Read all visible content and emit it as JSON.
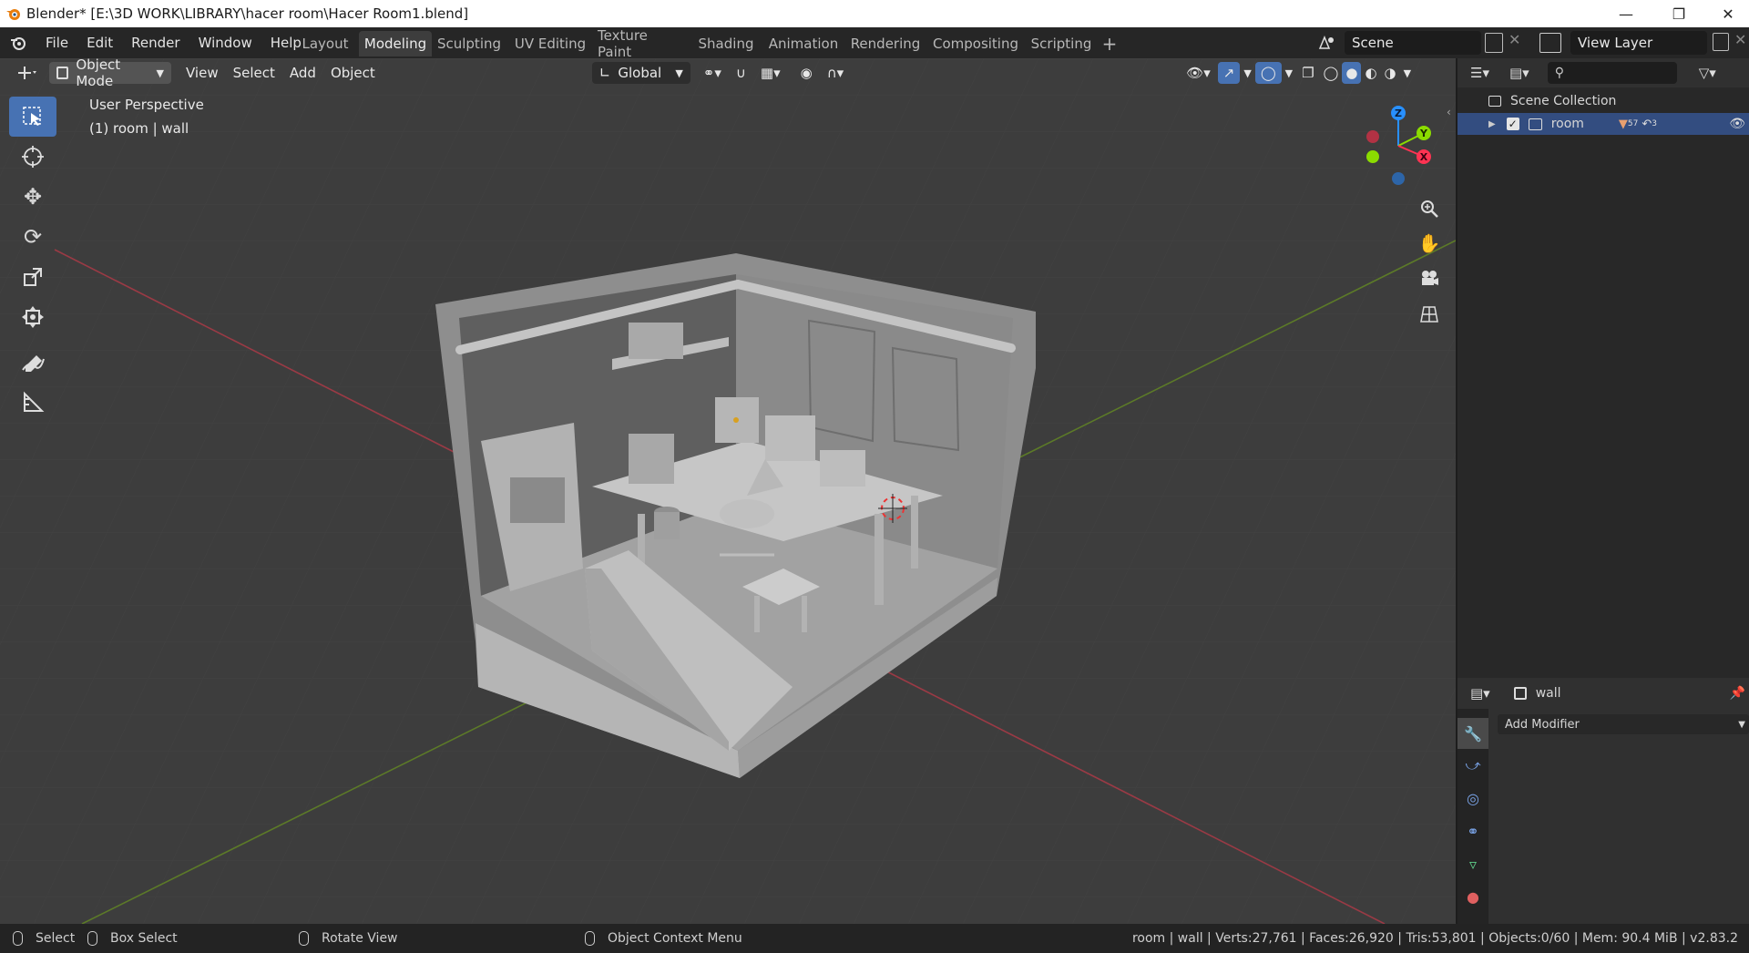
{
  "window": {
    "title": "Blender* [E:\\3D WORK\\LIBRARY\\hacer room\\Hacer Room1.blend]"
  },
  "menu": [
    "File",
    "Edit",
    "Render",
    "Window",
    "Help"
  ],
  "workspaces": [
    "Layout",
    "Modeling",
    "Sculpting",
    "UV Editing",
    "Texture Paint",
    "Shading",
    "Animation",
    "Rendering",
    "Compositing",
    "Scripting"
  ],
  "active_workspace": "Modeling",
  "scene": {
    "name": "Scene",
    "view_layer": "View Layer"
  },
  "viewport_header": {
    "mode": "Object Mode",
    "menus": [
      "View",
      "Select",
      "Add",
      "Object"
    ],
    "orientation": "Global"
  },
  "viewport_overlay": {
    "perspective": "User Perspective",
    "context": "(1) room | wall"
  },
  "gizmo": {
    "x": "X",
    "y": "Y",
    "z": "Z"
  },
  "outliner": {
    "root": "Scene Collection",
    "items": [
      {
        "label": "room",
        "badge1": "57",
        "badge2": "3"
      }
    ]
  },
  "properties": {
    "object_name": "wall",
    "add_modifier": "Add Modifier"
  },
  "statusbar": {
    "select": "Select",
    "box_select": "Box Select",
    "rotate": "Rotate View",
    "context_menu": "Object Context Menu",
    "stats": "room | wall | Verts:27,761 | Faces:26,920 | Tris:53,801 | Objects:0/60 | Mem: 90.4 MiB | v2.83.2"
  },
  "colors": {
    "accent": "#4772b3",
    "axis_x": "#ff3352",
    "axis_y": "#8bdc00",
    "axis_z": "#2890ff"
  }
}
